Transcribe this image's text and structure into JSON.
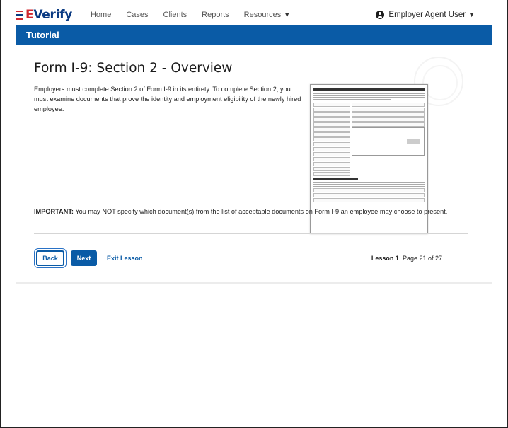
{
  "app": {
    "logo_prefix": "E",
    "logo_text": "Verify"
  },
  "nav": {
    "items": [
      "Home",
      "Cases",
      "Clients",
      "Reports",
      "Resources"
    ],
    "user_label": "Employer Agent User"
  },
  "tutorial_bar": {
    "title": "Tutorial"
  },
  "page": {
    "heading": "Form I-9: Section 2 - Overview",
    "intro": "Employers must complete Section 2 of Form I-9 in its entirety. To complete Section 2, you must examine documents that prove the identity and employment eligibility of the newly hired employee.",
    "important_label": "IMPORTANT:",
    "important_text": " You may NOT specify which document(s) from the list of acceptable documents on Form I-9 an employee may choose to present."
  },
  "footer": {
    "back_label": "Back",
    "next_label": "Next",
    "exit_label": "Exit Lesson",
    "lesson_label": "Lesson 1",
    "page_label": "Page 21 of 27"
  },
  "colors": {
    "brand_blue": "#0a5ba6",
    "logo_red": "#d0272f"
  }
}
